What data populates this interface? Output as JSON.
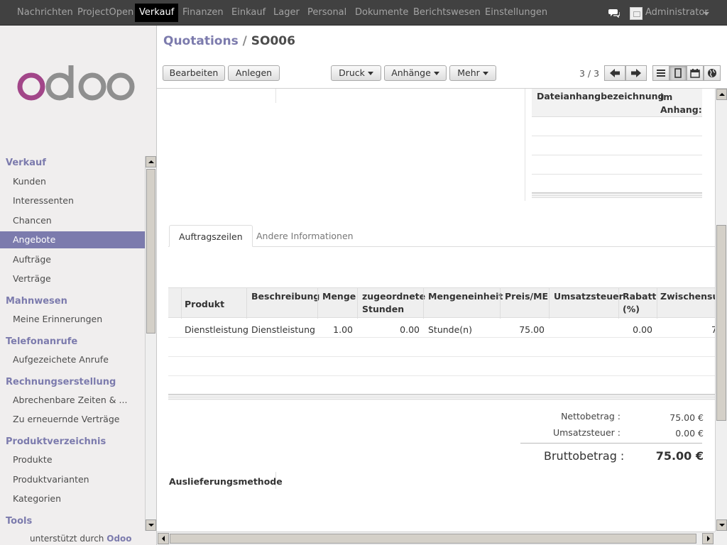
{
  "topnav": {
    "items": [
      "Nachrichten",
      "ProjectOpen",
      "Verkauf",
      "Finanzen",
      "Einkauf",
      "Lager",
      "Personal",
      "Dokumente",
      "Berichtswesen",
      "Einstellungen"
    ],
    "active": "Verkauf",
    "user": "Administrator"
  },
  "sidebar": {
    "logo_text": "odoo",
    "sections": [
      {
        "title": "Verkauf",
        "items": [
          "Kunden",
          "Interessenten",
          "Chancen",
          "Angebote",
          "Aufträge",
          "Verträge"
        ]
      },
      {
        "title": "Mahnwesen",
        "items": [
          "Meine Erinnerungen"
        ]
      },
      {
        "title": "Telefonanrufe",
        "items": [
          "Aufgezeichete Anrufe"
        ]
      },
      {
        "title": "Rechnungserstellung",
        "items": [
          "Abrechenbare Zeiten & ...",
          "Zu erneuernde Verträge"
        ]
      },
      {
        "title": "Produktverzeichnis",
        "items": [
          "Produkte",
          "Produktvarianten",
          "Kategorien"
        ]
      },
      {
        "title": "Tools",
        "items": []
      }
    ],
    "active_item": "Angebote",
    "powered_prefix": "unterstützt durch",
    "powered_brand": "Odoo"
  },
  "header": {
    "breadcrumb_parent": "Quotations",
    "breadcrumb_sep": "/",
    "breadcrumb_current": "SO006",
    "buttons": {
      "edit": "Bearbeiten",
      "create": "Anlegen",
      "print": "Druck",
      "attachments": "Anhänge",
      "more": "Mehr"
    },
    "pager": "3 / 3"
  },
  "attachments": {
    "col_name": "Dateianhangbezeichnung",
    "col_in": "im Anhang:"
  },
  "tabs": {
    "lines": "Auftragszeilen",
    "other": "Andere Informationen"
  },
  "order_lines": {
    "columns": [
      "Produkt",
      "Beschreibung",
      "Menge",
      "zugeordnete Stunden",
      "Mengeneinheit",
      "Preis/ME",
      "Umsatzsteuer",
      "Rabatt (%)",
      "Zwischensumme"
    ],
    "column_lines": {
      "hours": [
        "zugeordnete",
        "Stunden"
      ],
      "discount": [
        "Rabatt",
        "(%)"
      ],
      "subtotal_visible": "Zwischensur"
    },
    "rows": [
      {
        "product": "Dienstleistung",
        "description": "Dienstleistung",
        "qty": "1.00",
        "hours": "0.00",
        "uom": "Stunde(n)",
        "price": "75.00",
        "tax": "",
        "discount": "0.00",
        "subtotal_visible": "7"
      }
    ]
  },
  "totals": {
    "net_label": "Nettobetrag :",
    "net_value": "75.00 €",
    "tax_label": "Umsatzsteuer :",
    "tax_value": "0.00 €",
    "gross_label": "Bruttobetrag :",
    "gross_value": "75.00 €"
  },
  "delivery_label": "Auslieferungsmethode",
  "colors": {
    "topbar": "#414141",
    "accent": "#7c7bad",
    "active_item_bg": "#7c7bad",
    "sidebar_bg": "#f0eeee"
  }
}
